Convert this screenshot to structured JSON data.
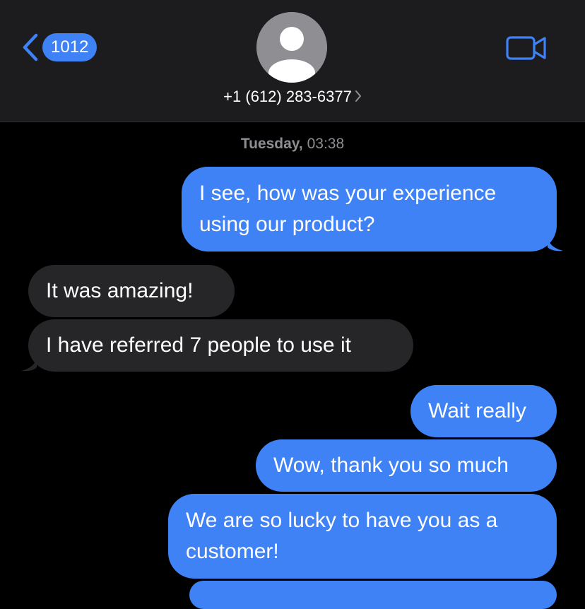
{
  "header": {
    "back_count": "1012",
    "contact_number": "+1 (612) 283-6377",
    "back_icon": "chevron-left-icon",
    "video_icon": "video-camera-icon",
    "avatar_icon": "person-silhouette-icon",
    "accent_color": "#3e82f5"
  },
  "conversation": {
    "timestamp_day": "Tuesday,",
    "timestamp_time": "03:38",
    "messages": [
      {
        "direction": "outgoing",
        "text": "I see, how was your experience using our product?"
      },
      {
        "direction": "incoming",
        "text": "It was amazing!"
      },
      {
        "direction": "incoming",
        "text": "I have referred 7 people to use it"
      },
      {
        "direction": "outgoing",
        "text": "Wait really"
      },
      {
        "direction": "outgoing",
        "text": "Wow, thank you so much"
      },
      {
        "direction": "outgoing",
        "text": "We are so lucky to have you as a customer!"
      }
    ]
  },
  "colors": {
    "outgoing_bubble": "#3e82f5",
    "incoming_bubble": "#262628",
    "background": "#000000",
    "header_bg": "#1c1c1e"
  }
}
